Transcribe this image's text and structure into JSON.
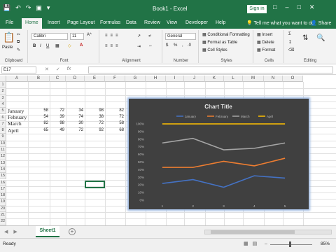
{
  "window": {
    "title": "Book1  -  Excel",
    "signin": "Sign in"
  },
  "tabs": [
    {
      "label": "File"
    },
    {
      "label": "Home"
    },
    {
      "label": "Insert"
    },
    {
      "label": "Page Layout"
    },
    {
      "label": "Formulas"
    },
    {
      "label": "Data"
    },
    {
      "label": "Review"
    },
    {
      "label": "View"
    },
    {
      "label": "Developer"
    },
    {
      "label": "Help"
    }
  ],
  "tell_me": "Tell me what you want to do",
  "share": "Share",
  "ribbon": {
    "groups": {
      "clipboard": "Clipboard",
      "font": "Font",
      "alignment": "Alignment",
      "number": "Number",
      "styles": "Styles",
      "cells": "Cells",
      "editing": "Editing"
    },
    "paste": "Paste",
    "font_name": "Calibri",
    "font_size": "11",
    "number_format": "General",
    "cond_format": "Conditional Formatting",
    "format_table": "Format as Table",
    "cell_styles": "Cell Styles",
    "insert": "Insert",
    "delete": "Delete",
    "format": "Format",
    "bold": "B",
    "italic": "I",
    "underline": "U"
  },
  "formula_bar": {
    "name_box": "E17",
    "fx": "fx"
  },
  "grid": {
    "columns": [
      "A",
      "B",
      "C",
      "D",
      "E",
      "F",
      "G",
      "H",
      "I",
      "J",
      "K",
      "L",
      "M",
      "N",
      "O"
    ],
    "rows": [
      "1",
      "2",
      "3",
      "4",
      "5",
      "6",
      "7",
      "8",
      "9",
      "10",
      "11",
      "12",
      "13",
      "14",
      "15",
      "16",
      "17",
      "18",
      "19",
      "20",
      "21",
      "22",
      "23"
    ],
    "data": [
      {
        "label": "January",
        "values": [
          "58",
          "72",
          "34",
          "98",
          "82"
        ]
      },
      {
        "label": "February",
        "values": [
          "54",
          "39",
          "74",
          "38",
          "72"
        ]
      },
      {
        "label": "March",
        "values": [
          "82",
          "98",
          "30",
          "72",
          "58"
        ]
      },
      {
        "label": "April",
        "values": [
          "65",
          "49",
          "72",
          "92",
          "68"
        ]
      }
    ]
  },
  "chart_data": {
    "type": "line",
    "title": "Chart Title",
    "categories": [
      "1",
      "2",
      "3",
      "4",
      "5"
    ],
    "y_ticks": [
      "0%",
      "10%",
      "20%",
      "30%",
      "40%",
      "50%",
      "60%",
      "70%",
      "80%",
      "90%",
      "100%"
    ],
    "ylim": [
      0,
      1
    ],
    "legend_position": "top",
    "series": [
      {
        "name": "January",
        "color": "#4472c4",
        "values": [
          0.22,
          0.27,
          0.17,
          0.32,
          0.29
        ]
      },
      {
        "name": "February",
        "color": "#ed7d31",
        "values": [
          0.43,
          0.43,
          0.51,
          0.45,
          0.55
        ]
      },
      {
        "name": "March",
        "color": "#a5a5a5",
        "values": [
          0.75,
          0.81,
          0.66,
          0.68,
          0.75
        ]
      },
      {
        "name": "April",
        "color": "#ffc000",
        "values": [
          1.0,
          1.0,
          1.0,
          1.0,
          1.0
        ]
      }
    ]
  },
  "sheets": [
    {
      "label": "Sheet1"
    }
  ],
  "status": {
    "ready": "Ready",
    "zoom": "85%"
  },
  "colors": {
    "accent": "#217346",
    "chart_bg": "#404040"
  }
}
